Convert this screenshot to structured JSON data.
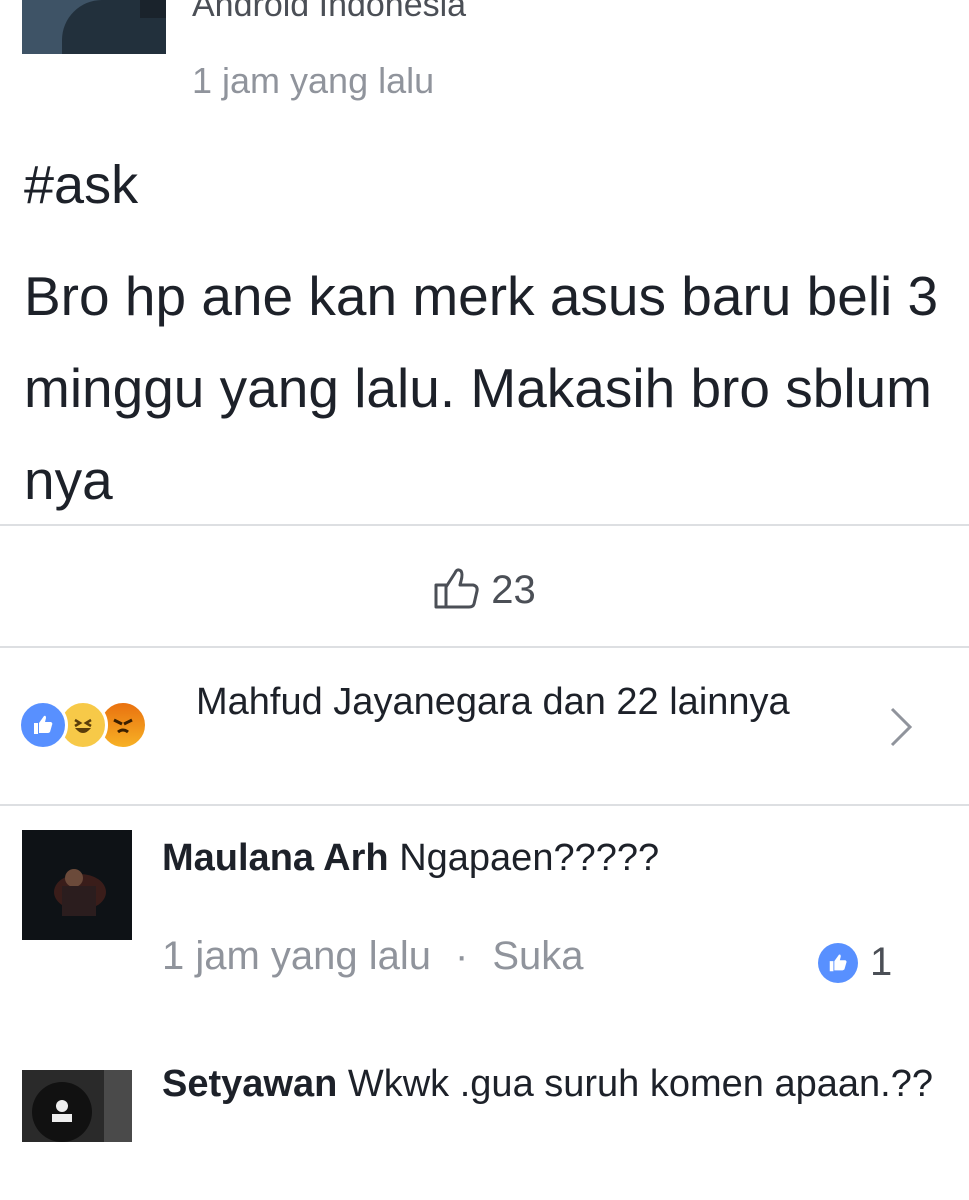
{
  "post": {
    "group_name": "Android Indonesia",
    "time": "1 jam yang lalu",
    "hashtag": "#ask",
    "text": "Bro hp ane kan merk asus baru beli 3 minggu yang lalu. Makasih bro sblum nya",
    "like_count": "23"
  },
  "reactions": {
    "icons": [
      "like-icon",
      "haha-icon",
      "angry-icon"
    ],
    "text": "Mahfud Jayanegara dan 22 lainnya"
  },
  "comments": [
    {
      "author": "Maulana Arh",
      "text": "Ngapaen?????",
      "time": "1 jam yang lalu",
      "separator": "·",
      "like_label": "Suka",
      "like_count": "1"
    },
    {
      "author": "Setyawan",
      "text": "Wkwk .gua suruh komen apaan.??"
    }
  ],
  "colors": {
    "like_blue": "#5890ff",
    "meta_gray": "#90949c",
    "text": "#1d2129"
  }
}
